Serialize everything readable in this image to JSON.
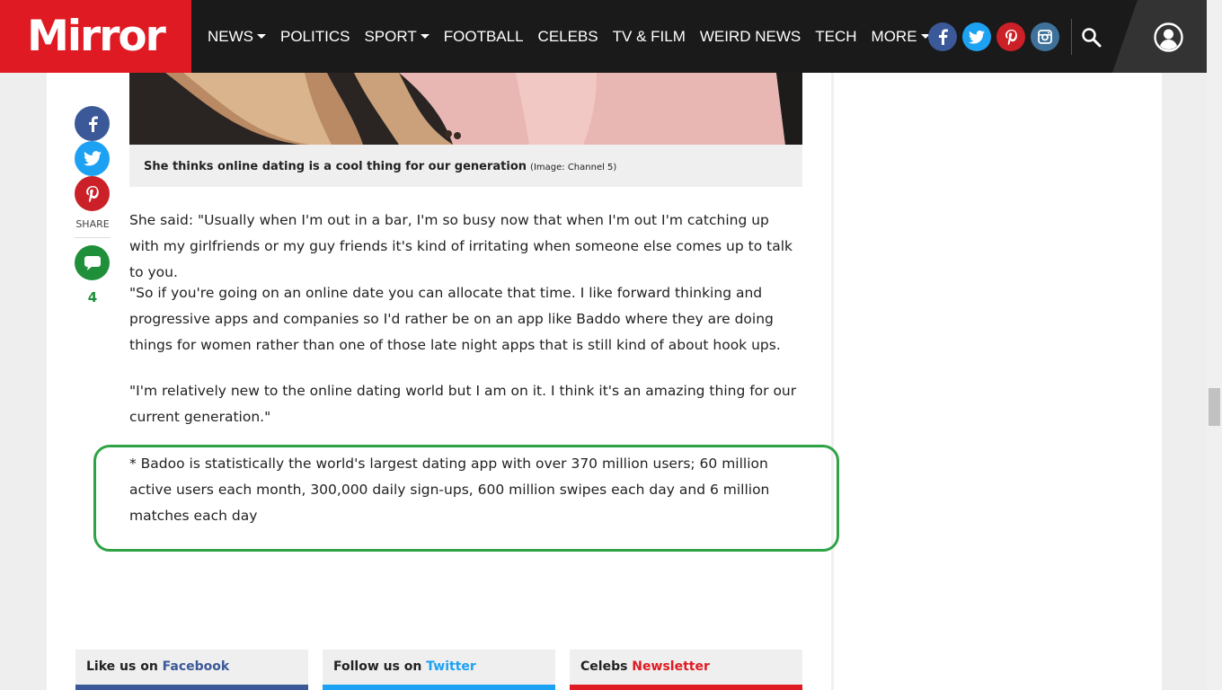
{
  "header": {
    "logo": "Mirror",
    "nav": [
      {
        "label": "NEWS",
        "dropdown": true
      },
      {
        "label": "POLITICS",
        "dropdown": false
      },
      {
        "label": "SPORT",
        "dropdown": true
      },
      {
        "label": "FOOTBALL",
        "dropdown": false
      },
      {
        "label": "CELEBS",
        "dropdown": false
      },
      {
        "label": "TV & FILM",
        "dropdown": false
      },
      {
        "label": "WEIRD NEWS",
        "dropdown": false
      },
      {
        "label": "TECH",
        "dropdown": false
      },
      {
        "label": "MORE",
        "dropdown": true
      }
    ],
    "social": [
      {
        "name": "facebook-icon",
        "glyph": "f",
        "color": "#3b5998"
      },
      {
        "name": "twitter-icon",
        "glyph": "t",
        "color": "#1da1f2"
      },
      {
        "name": "pinterest-icon",
        "glyph": "p",
        "color": "#cb2027"
      },
      {
        "name": "instagram-icon",
        "glyph": "i",
        "color": "#3f729b"
      }
    ]
  },
  "colors": {
    "brand": "#e01a22",
    "facebook": "#3b5998",
    "twitter": "#1da1f2",
    "pinterest": "#cb2027",
    "comments": "#1f8f3a",
    "highlight": "#2ea346"
  },
  "share": {
    "label": "SHARE",
    "comment_count": "4"
  },
  "caption": {
    "text": "She thinks online dating is a cool thing for our generation",
    "credit": "(Image: Channel 5)"
  },
  "article": {
    "paragraphs": [
      "She said: \"Usually when I'm out in a bar, I'm so busy now that when I'm out I'm catching up with my girlfriends or my guy friends it's kind of irritating when someone else comes up to talk to you.",
      "\"So if you're going on an online date you can allocate that time. I like forward thinking and progressive apps and companies so I'd rather be on an app like Baddo where they are doing things for women rather than one of those late night apps that is still kind of about hook ups.",
      "\"I'm relatively new to the online dating world but I am on it. I think it's an amazing thing for our current generation.\"",
      "* Badoo is statistically the world's largest dating app with over 370 million users; 60 million active users each month, 300,000 daily sign-ups, 600 million swipes each day and 6 million matches each day"
    ]
  },
  "promos": [
    {
      "prefix": "Like us on ",
      "highlight": "Facebook",
      "color": "#3b5998"
    },
    {
      "prefix": "Follow us on ",
      "highlight": "Twitter",
      "color": "#1da1f2"
    },
    {
      "prefix": "Celebs ",
      "highlight": "Newsletter",
      "color": "#e01a22"
    }
  ]
}
